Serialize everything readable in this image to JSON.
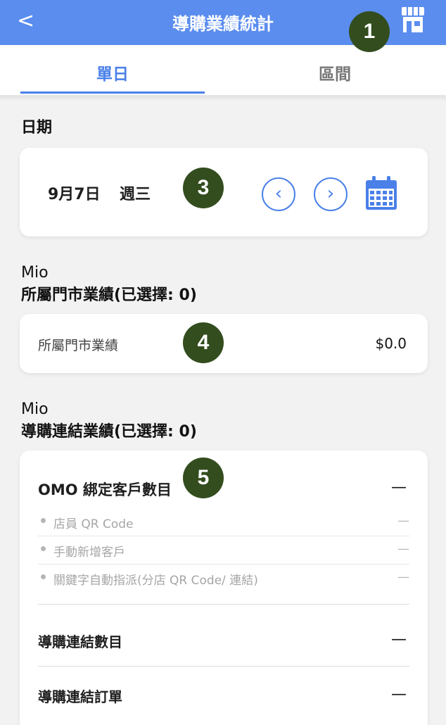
{
  "header": {
    "back_label": "<",
    "title": "導購業績統計",
    "store_icon": "store-icon"
  },
  "tabs": [
    {
      "label": "單日",
      "active": true
    },
    {
      "label": "區間",
      "active": false
    }
  ],
  "date_section": {
    "label": "日期",
    "date": "9月7日",
    "weekday": "週三",
    "prev_glyph": "‹",
    "next_glyph": "›",
    "calendar_icon": "calendar-icon"
  },
  "store_section": {
    "name": "Mio",
    "label": "所屬門市業績(已選擇: 0)",
    "row_label": "所屬門市業績",
    "row_value": "$0.0"
  },
  "link_section": {
    "name": "Mio",
    "label": "導購連結業績(已選擇: 0)",
    "omo_title": "OMO 綁定客戶數目",
    "omo_value": "—",
    "sub_items": [
      {
        "label": "店員 QR Code",
        "value": "—"
      },
      {
        "label": "手動新增客戶",
        "value": "—"
      },
      {
        "label": "關鍵字自動指派(分店 QR Code/ 連結)",
        "value": "—"
      }
    ],
    "link_count_label": "導購連結數目",
    "link_count_value": "—",
    "link_order_label": "導購連結訂單",
    "link_order_value": "—"
  },
  "badges": [
    "1",
    "3",
    "4",
    "5"
  ],
  "colors": {
    "header": "#5b8def",
    "accent": "#4a80e8",
    "badge": "#334d1e",
    "background": "#f2f2f2"
  }
}
